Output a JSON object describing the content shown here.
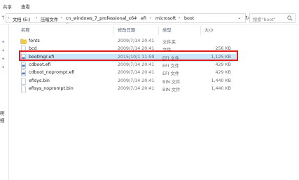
{
  "ribbon": {
    "tabs": [
      "共享",
      "查看"
    ]
  },
  "address": {
    "crumbs": [
      "文档 (E:)",
      "压缩文件",
      "cn_windows_7_professional_x64",
      "efi",
      "microsoft",
      "boot"
    ],
    "search_placeholder": "搜索\"boot\""
  },
  "navpane": {
    "label": "明细"
  },
  "columns": {
    "name": "名称",
    "date": "修改日期",
    "type": "类型",
    "size": "大小"
  },
  "files": [
    {
      "name": "fonts",
      "date": "2009/7/14 20:41",
      "type": "文件夹",
      "size": "",
      "icon": "folder-icon"
    },
    {
      "name": "bcd",
      "date": "2009/7/14 20:41",
      "type": "文件",
      "size": "256 KB",
      "icon": "file-icon"
    },
    {
      "name": "bootmgr.efi",
      "date": "2015/10/1 11:59",
      "type": "EFI 文件",
      "size": "1,125 KB",
      "icon": "efi-file-icon",
      "selected": true
    },
    {
      "name": "cdboot.efi",
      "date": "2009/7/14 20:41",
      "type": "EFI 文件",
      "size": "429 KB",
      "icon": "efi-file-icon"
    },
    {
      "name": "cdboot_noprompt.efi",
      "date": "2009/7/14 20:41",
      "type": "EFI 文件",
      "size": "429 KB",
      "icon": "efi-file-icon"
    },
    {
      "name": "efisys.bin",
      "date": "2009/7/14 20:41",
      "type": "BIN 文件",
      "size": "1,440 KB",
      "icon": "bin-file-icon"
    },
    {
      "name": "efisys_noprompt.bin",
      "date": "2009/7/14 20:41",
      "type": "BIN 文件",
      "size": "1,440 KB",
      "icon": "bin-file-icon"
    }
  ],
  "colors": {
    "selection": "#cce8ff",
    "highlight_border": "#e01b1b",
    "folder": "#f3c94a"
  }
}
